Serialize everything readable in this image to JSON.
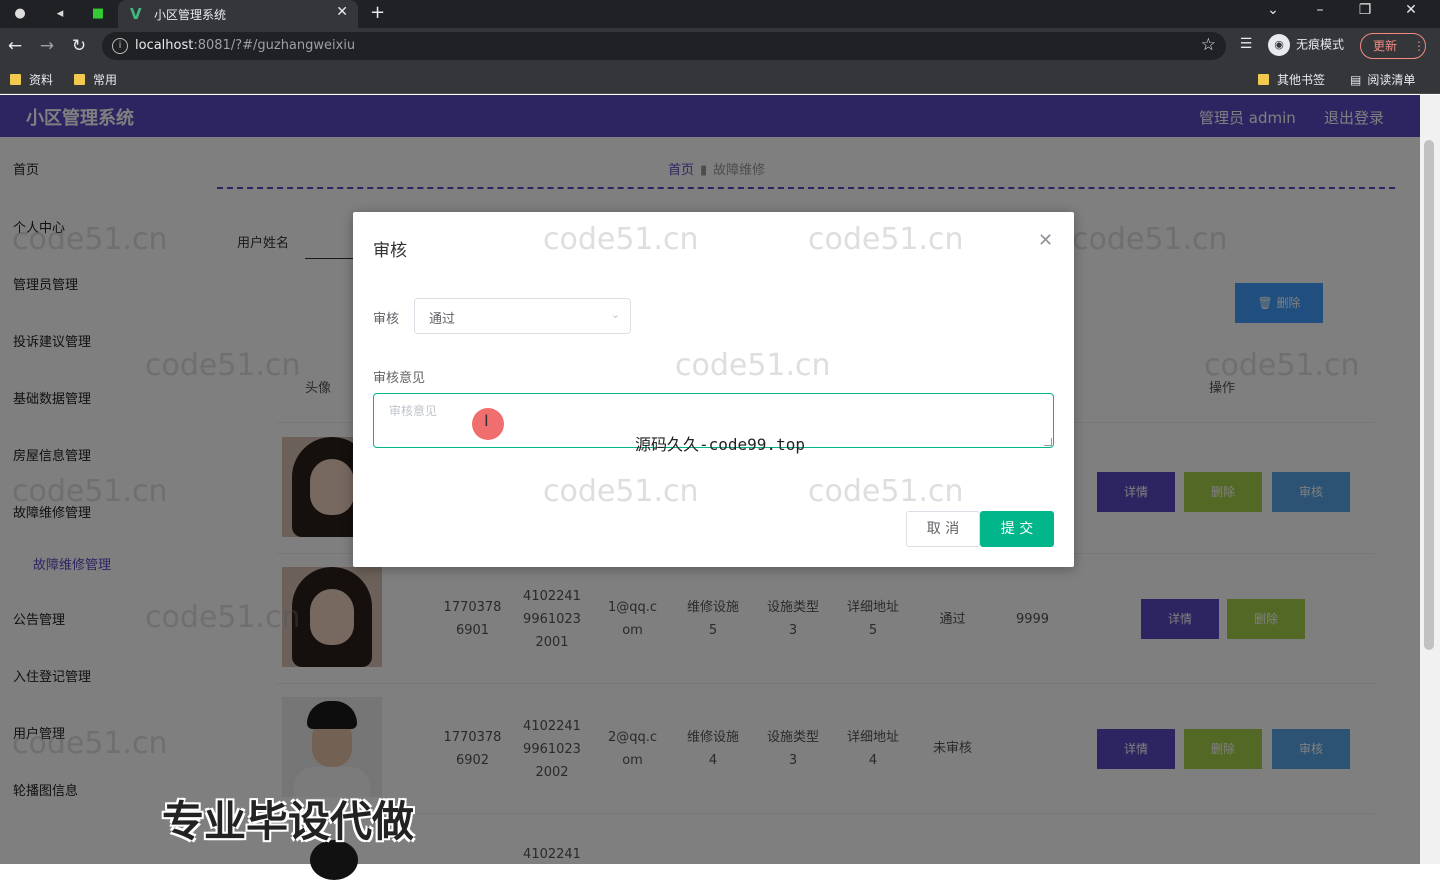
{
  "browser": {
    "tab_title": "小区管理系统",
    "url_host": "localhost",
    "url_rest": ":8081/?#/guzhangweixiu",
    "incognito_label": "无痕模式",
    "update_label": "更新",
    "bookmarks": [
      "资料",
      "常用"
    ],
    "bookmarks_right": [
      "其他书签",
      "阅读清单"
    ]
  },
  "app": {
    "title": "小区管理系统",
    "admin_label": "管理员 admin",
    "logout_label": "退出登录",
    "accent_color": "#5b4bc4"
  },
  "sidebar": {
    "items": [
      "首页",
      "个人中心",
      "管理员管理",
      "投诉建议管理",
      "基础数据管理",
      "房屋信息管理",
      "故障维修管理",
      "公告管理",
      "入住登记管理",
      "用户管理",
      "轮播图信息"
    ],
    "subitem": "故障维修管理"
  },
  "breadcrumb": {
    "home": "首页",
    "current": "故障维修"
  },
  "search": {
    "label": "用户姓名"
  },
  "bulk_delete_label": "删除",
  "table": {
    "headers": {
      "avatar": "头像",
      "action": "操作"
    },
    "rows": [
      {
        "phone": "1770378 6901",
        "id_line1": "4102241",
        "id_line2": "9961023",
        "id_line3": "2001",
        "email_line1": "1@qq.c",
        "email_line2": "om",
        "facility_line1": "维修设施",
        "facility_line2": "5",
        "type_line1": "设施类型",
        "type_line2": "3",
        "addr_line1": "详细地址",
        "addr_line2": "5",
        "status": "通过",
        "opinion": "9999"
      },
      {
        "phone": "1770378 6902",
        "id_line1": "4102241",
        "id_line2": "9961023",
        "id_line3": "2002",
        "email_line1": "2@qq.c",
        "email_line2": "om",
        "facility_line1": "维修设施",
        "facility_line2": "4",
        "type_line1": "设施类型",
        "type_line2": "3",
        "addr_line1": "详细地址",
        "addr_line2": "4",
        "status": "未审核",
        "opinion": ""
      },
      {
        "id_line1": "4102241"
      }
    ],
    "btn_detail": "详情",
    "btn_delete": "删除",
    "btn_audit": "审核"
  },
  "dialog": {
    "title": "审核",
    "field_audit_label": "审核",
    "field_audit_value": "通过",
    "field_opinion_label": "审核意见",
    "opinion_placeholder": "审核意见",
    "cancel_label": "取 消",
    "submit_label": "提 交",
    "submit_color": "#00b68a"
  },
  "watermark": "code51.cn",
  "overlay_text_center": "源码久久-code99.top",
  "overlay_text_bottom": "专业毕设代做"
}
